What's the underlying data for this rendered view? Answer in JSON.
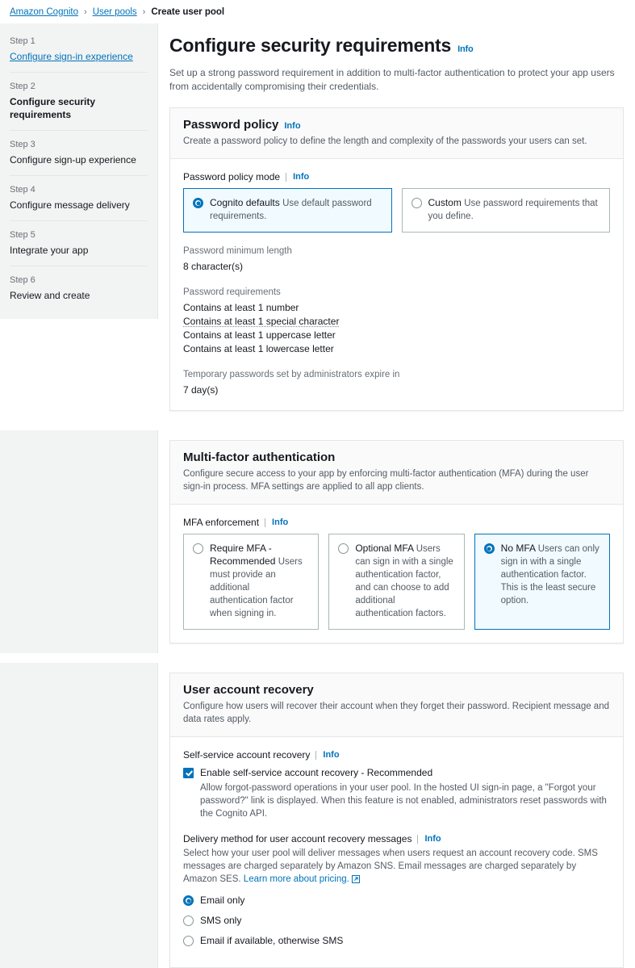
{
  "breadcrumb": {
    "items": [
      {
        "label": "Amazon Cognito",
        "link": true
      },
      {
        "label": "User pools",
        "link": true
      },
      {
        "label": "Create user pool",
        "link": false
      }
    ],
    "separator": "›"
  },
  "sidebar": {
    "steps": [
      {
        "step": "Step 1",
        "name": "Configure sign-in experience",
        "state": "link"
      },
      {
        "step": "Step 2",
        "name": "Configure security requirements",
        "state": "active"
      },
      {
        "step": "Step 3",
        "name": "Configure sign-up experience",
        "state": "plain"
      },
      {
        "step": "Step 4",
        "name": "Configure message delivery",
        "state": "plain"
      },
      {
        "step": "Step 5",
        "name": "Integrate your app",
        "state": "plain"
      },
      {
        "step": "Step 6",
        "name": "Review and create",
        "state": "plain"
      }
    ]
  },
  "header": {
    "title": "Configure security requirements",
    "info_label": "Info",
    "description": "Set up a strong password requirement in addition to multi-factor authentication to protect your app users from accidentally compromising their credentials."
  },
  "password_policy": {
    "title": "Password policy",
    "info_label": "Info",
    "description": "Create a password policy to define the length and complexity of the passwords your users can set.",
    "mode_label": "Password policy mode",
    "mode_info_label": "Info",
    "modes": [
      {
        "title": "Cognito defaults",
        "desc": "Use default password requirements.",
        "selected": true
      },
      {
        "title": "Custom",
        "desc": "Use password requirements that you define.",
        "selected": false
      }
    ],
    "min_length_label": "Password minimum length",
    "min_length_value": "8 character(s)",
    "requirements_label": "Password requirements",
    "requirements": [
      {
        "text": "Contains at least 1 number",
        "dotted": false
      },
      {
        "text": "Contains at least 1 special character",
        "dotted": true
      },
      {
        "text": "Contains at least 1 uppercase letter",
        "dotted": false
      },
      {
        "text": "Contains at least 1 lowercase letter",
        "dotted": false
      }
    ],
    "temp_password_label": "Temporary passwords set by administrators expire in",
    "temp_password_value": "7 day(s)"
  },
  "mfa": {
    "title": "Multi-factor authentication",
    "description": "Configure secure access to your app by enforcing multi-factor authentication (MFA) during the user sign-in process. MFA settings are applied to all app clients.",
    "enforcement_label": "MFA enforcement",
    "enforcement_info_label": "Info",
    "options": [
      {
        "title": "Require MFA - Recommended",
        "desc": "Users must provide an additional authentication factor when signing in.",
        "selected": false
      },
      {
        "title": "Optional MFA",
        "desc": "Users can sign in with a single authentication factor, and can choose to add additional authentication factors.",
        "selected": false
      },
      {
        "title": "No MFA",
        "desc": "Users can only sign in with a single authentication factor. This is the least secure option.",
        "selected": true
      }
    ]
  },
  "account_recovery": {
    "title": "User account recovery",
    "description": "Configure how users will recover their account when they forget their password. Recipient message and data rates apply.",
    "self_service_label": "Self-service account recovery",
    "self_service_info_label": "Info",
    "enable_label": "Enable self-service account recovery - Recommended",
    "enable_checked": true,
    "enable_desc": "Allow forgot-password operations in your user pool. In the hosted UI sign-in page, a \"Forgot your password?\" link is displayed. When this feature is not enabled, administrators reset passwords with the Cognito API.",
    "delivery_label": "Delivery method for user account recovery messages",
    "delivery_info_label": "Info",
    "delivery_desc": "Select how your user pool will deliver messages when users request an account recovery code. SMS messages are charged separately by Amazon SNS. Email messages are charged separately by Amazon SES.",
    "delivery_link_text": "Learn more about pricing.",
    "delivery_options": [
      {
        "label": "Email only",
        "selected": true
      },
      {
        "label": "SMS only",
        "selected": false
      },
      {
        "label": "Email if available, otherwise SMS",
        "selected": false
      }
    ]
  },
  "colors": {
    "accent": "#0073bb",
    "page_bg": "#f2f3f3",
    "selected_tile_bg": "#f1faff",
    "border": "#e4e6e6",
    "muted_text": "#545b64"
  }
}
